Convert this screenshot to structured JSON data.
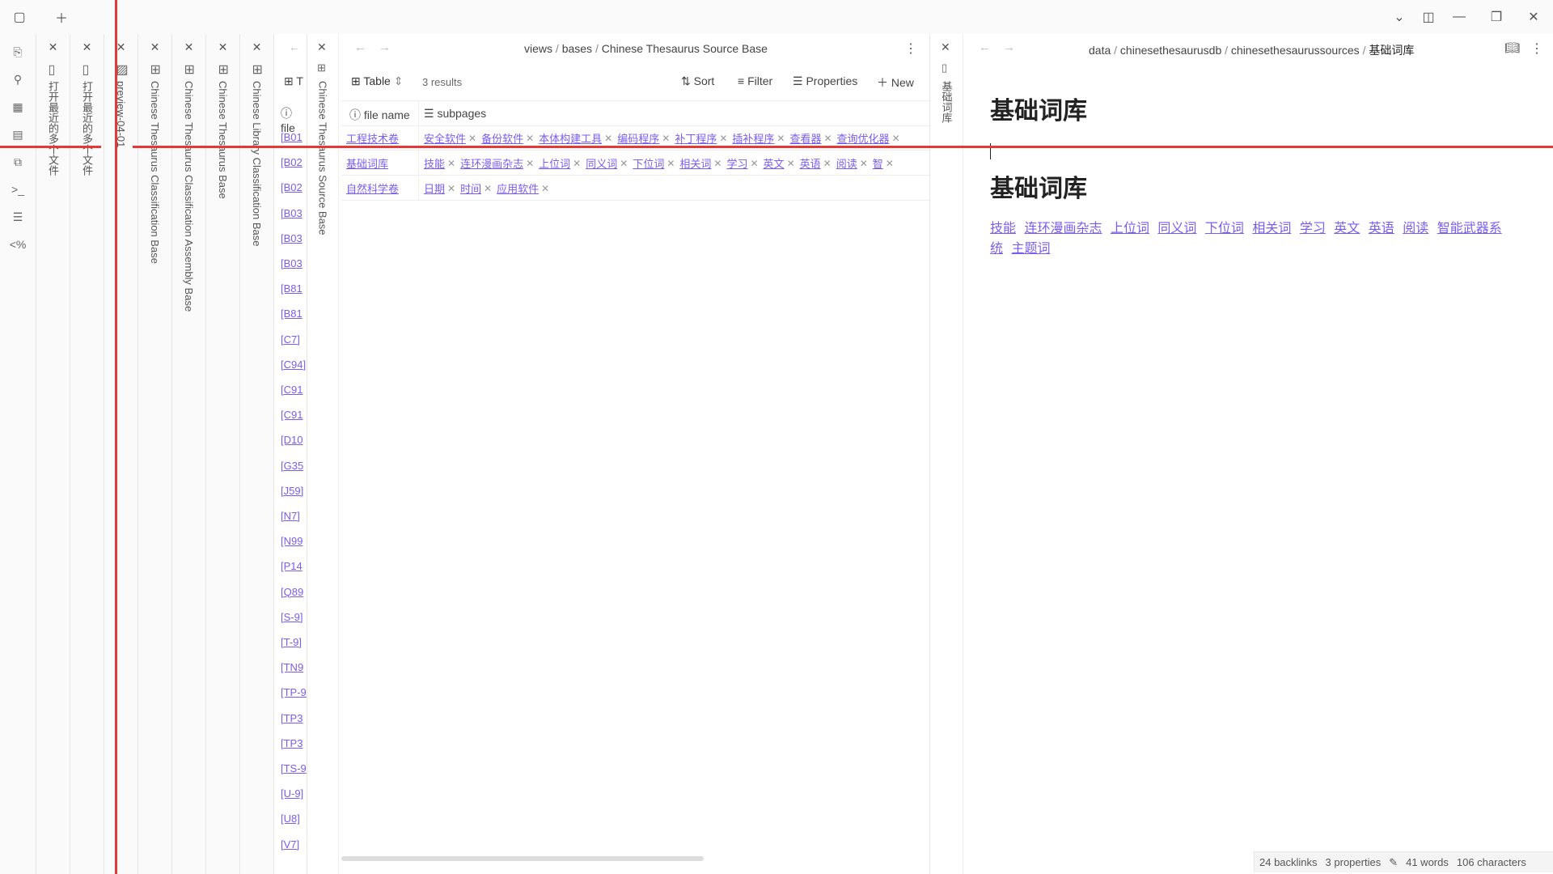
{
  "ribbon": {
    "icons": [
      "open-file-icon",
      "graph-icon",
      "canvas-icon",
      "calendar-icon",
      "templates-icon",
      "terminal-icon",
      "outline-icon",
      "code-icon"
    ]
  },
  "stacked_tabs": [
    {
      "title": "打开最近的多个文件"
    },
    {
      "title": "打开最近的多个文件"
    },
    {
      "title": "preview-04-01"
    },
    {
      "title": "Chinese Thesaurus Classification Base"
    },
    {
      "title": "Chinese Thesaurus Classification Assembly Base"
    },
    {
      "title": "Chinese Thesaurus Base"
    },
    {
      "title": "Chinese Library Classification Base"
    }
  ],
  "library_pane": {
    "header": "T",
    "col": "file",
    "rows": [
      "[B01",
      "[B02",
      "[B02",
      "[B03",
      "[B03",
      "[B03",
      "[B81",
      "[B81",
      "[C7]",
      "[C94]",
      "[C91",
      "[C91",
      "[D10",
      "[G35",
      "[J59]",
      "[N7]",
      "[N99",
      "[P14",
      "[Q89",
      "[S-9]",
      "[T-9]",
      "[TN9",
      "[TP-9",
      "[TP3",
      "[TP3",
      "[TS-9",
      "[U-9]",
      "[U8]",
      "[V7]"
    ]
  },
  "base_pane": {
    "side_title": "Chinese Thesaurus Source Base",
    "breadcrumb": [
      "views",
      "bases",
      "Chinese Thesaurus Source Base"
    ],
    "view_label": "Table",
    "results": "3 results",
    "toolbar": {
      "sort": "Sort",
      "filter": "Filter",
      "properties": "Properties",
      "new": "New"
    },
    "columns": [
      "file name",
      "subpages"
    ],
    "rows": [
      {
        "name": "工程技术卷",
        "chips": [
          "安全软件",
          "备份软件",
          "本体构建工具",
          "编码程序",
          "补丁程序",
          "插补程序",
          "查看器",
          "查询优化器"
        ]
      },
      {
        "name": "基础词库",
        "chips": [
          "技能",
          "连环漫画杂志",
          "上位词",
          "同义词",
          "下位词",
          "相关词",
          "学习",
          "英文",
          "英语",
          "阅读",
          "智"
        ]
      },
      {
        "name": "自然科学卷",
        "chips": [
          "日期",
          "时间",
          "应用软件"
        ]
      }
    ]
  },
  "note_pane": {
    "side_title": "基础词库",
    "breadcrumb": [
      "data",
      "chinesethesaurusdb",
      "chinesethesaurussources",
      "基础词库"
    ],
    "title": "基础词库",
    "heading": "基础词库",
    "links": [
      "技能",
      "连环漫画杂志",
      "上位词",
      "同义词",
      "下位词",
      "相关词",
      "学习",
      "英文",
      "英语",
      "阅读",
      "智能武器系统",
      "主题词"
    ]
  },
  "status": {
    "backlinks": "24 backlinks",
    "properties": "3 properties",
    "words": "41 words",
    "characters": "106 characters"
  }
}
